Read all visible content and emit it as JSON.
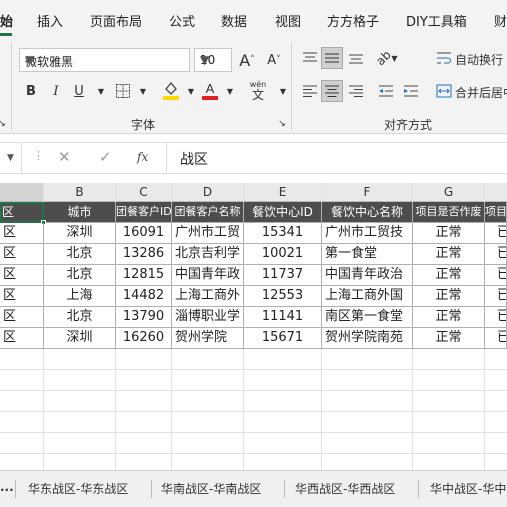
{
  "ribbon_tabs": [
    "始",
    "插入",
    "页面布局",
    "公式",
    "数据",
    "视图",
    "方方格子",
    "DIY工具箱",
    "财"
  ],
  "font": {
    "name": "微软雅黑",
    "size": "10",
    "grow": "A",
    "shrink": "A",
    "bold": "B",
    "italic": "I",
    "underline": "U",
    "phonetic_top": "wén",
    "phonetic_bottom": "文",
    "group_label": "字体"
  },
  "alignment": {
    "wrap_text": "自动换行",
    "merge_center": "合并后居中",
    "group_label": "对齐方式"
  },
  "formula_bar": {
    "fx": "fx",
    "content": "战区"
  },
  "colors": {
    "accent": "#217346",
    "header_fill": "#4d4d4d",
    "fill_yellow": "#ffd800",
    "font_red": "#e02020"
  },
  "columns": [
    "B",
    "C",
    "D",
    "E",
    "F",
    "G",
    ""
  ],
  "table": {
    "headers": [
      "区",
      "城市",
      "团餐客户ID",
      "团餐客户名称",
      "餐饮中心ID",
      "餐饮中心名称",
      "项目是否作废",
      "项目"
    ],
    "rows": [
      [
        "区",
        "深圳",
        "16091",
        "广州市工贸",
        "15341",
        "广州市工贸技",
        "正常",
        "已"
      ],
      [
        "区",
        "北京",
        "13286",
        "北京吉利学",
        "10021",
        "第一食堂",
        "正常",
        "已"
      ],
      [
        "区",
        "北京",
        "12815",
        "中国青年政",
        "11737",
        "中国青年政治",
        "正常",
        "已"
      ],
      [
        "区",
        "上海",
        "14482",
        "上海工商外",
        "12553",
        "上海工商外国",
        "正常",
        "已"
      ],
      [
        "区",
        "北京",
        "13790",
        "淄博职业学",
        "11141",
        "南区第一食堂",
        "正常",
        "已"
      ],
      [
        "区",
        "深圳",
        "16260",
        "贺州学院",
        "15671",
        "贺州学院南苑",
        "正常",
        "已"
      ]
    ]
  },
  "sheet_tabs": [
    "...",
    "华东战区-华东战区",
    "华南战区-华南战区",
    "华西战区-华西战区",
    "华中战区-华中"
  ]
}
